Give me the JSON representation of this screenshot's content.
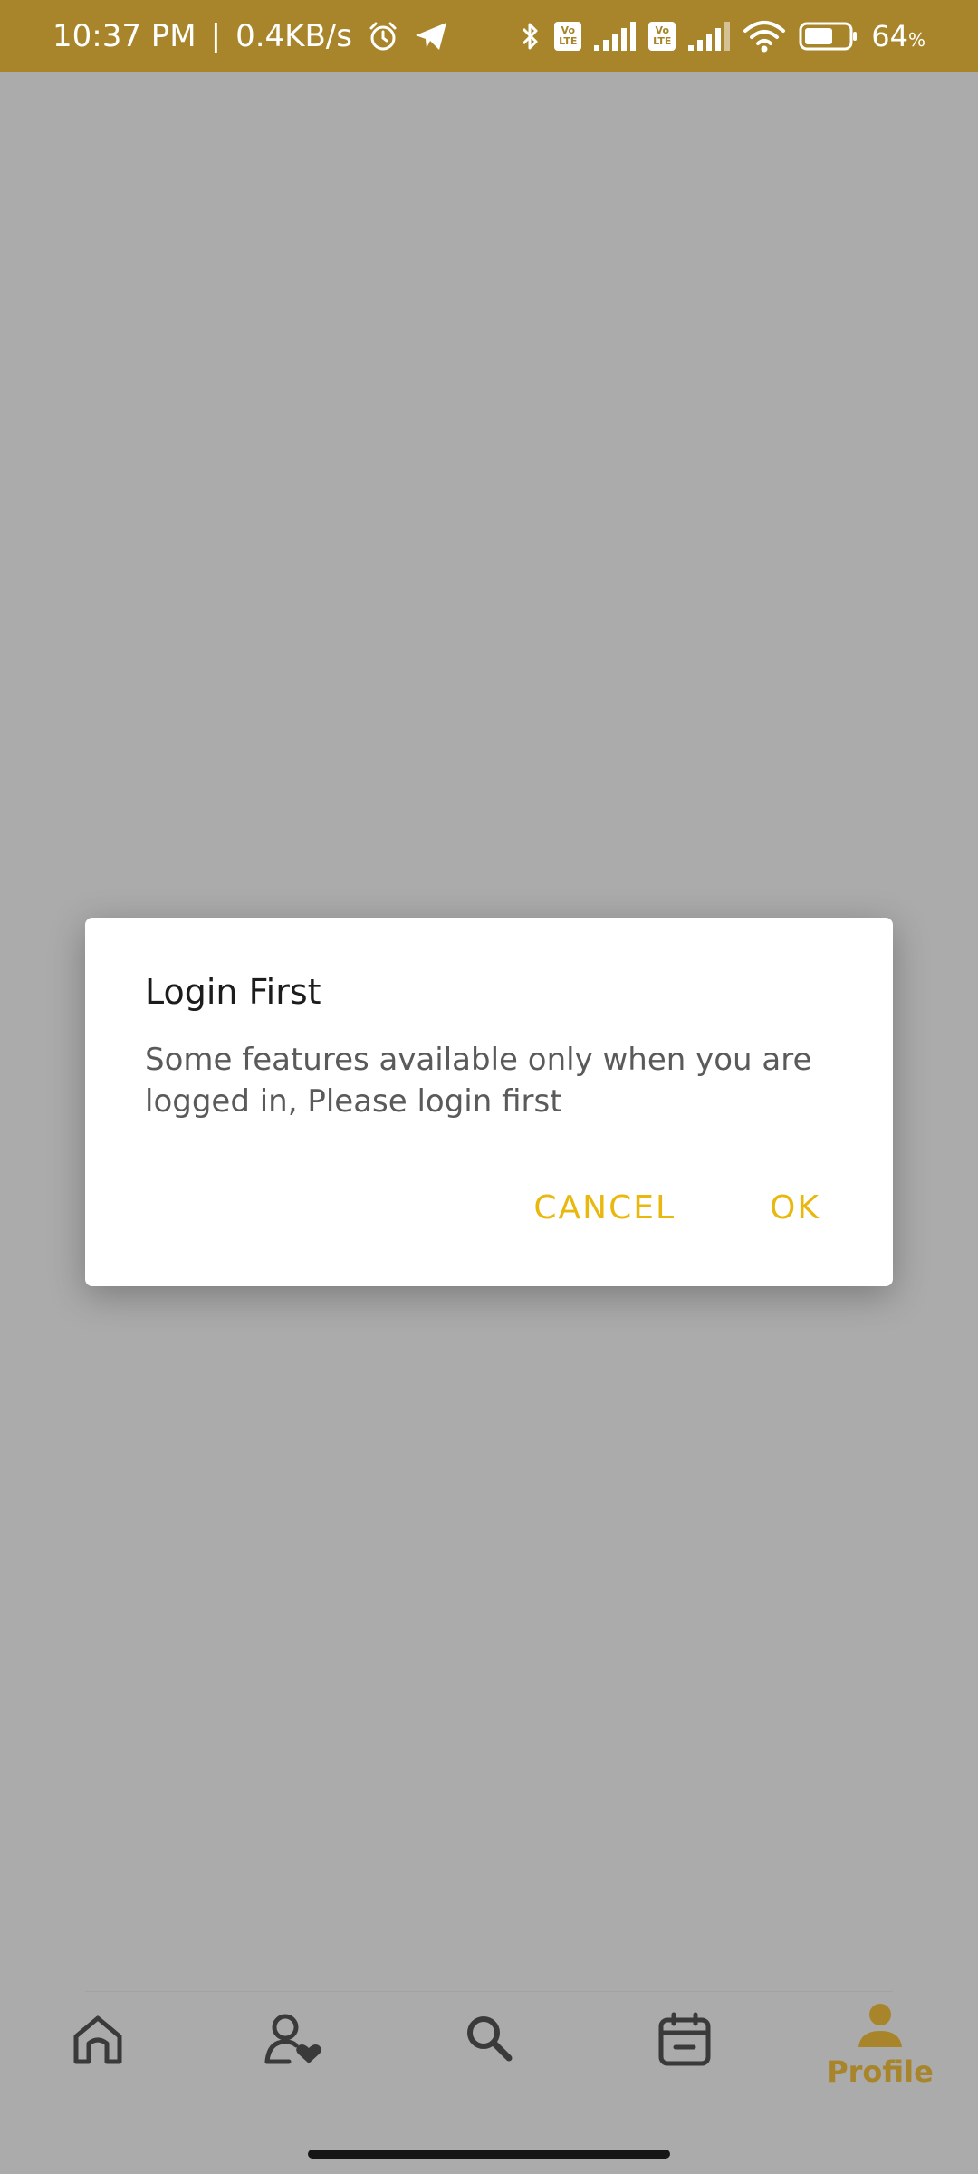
{
  "status_bar": {
    "time": "10:37 PM",
    "separator": "|",
    "network_speed": "0.4KB/s",
    "volte_top": "Vo",
    "volte_bottom": "LTE",
    "battery_value": "64",
    "battery_unit": "%",
    "icons": [
      "alarm-icon",
      "telegram-icon",
      "bluetooth-icon",
      "volte-icon",
      "signal-icon",
      "volte-icon",
      "signal-icon",
      "wifi-icon",
      "battery-icon"
    ]
  },
  "dialog": {
    "title": "Login First",
    "message": "Some features available only when you are logged in, Please login first",
    "cancel_label": "CANCEL",
    "ok_label": "OK"
  },
  "bottom_nav": {
    "items": [
      {
        "icon": "home-icon",
        "label": ""
      },
      {
        "icon": "favorite-user-icon",
        "label": ""
      },
      {
        "icon": "search-icon",
        "label": ""
      },
      {
        "icon": "calendar-icon",
        "label": ""
      },
      {
        "icon": "profile-icon",
        "label": "Profile",
        "active": true
      }
    ]
  },
  "colors": {
    "status_bar": "#a8852a",
    "accent": "#e9b80e",
    "active_nav": "#a8852a",
    "scrim": "#ababab",
    "inactive_icon": "#3a3a3a"
  }
}
